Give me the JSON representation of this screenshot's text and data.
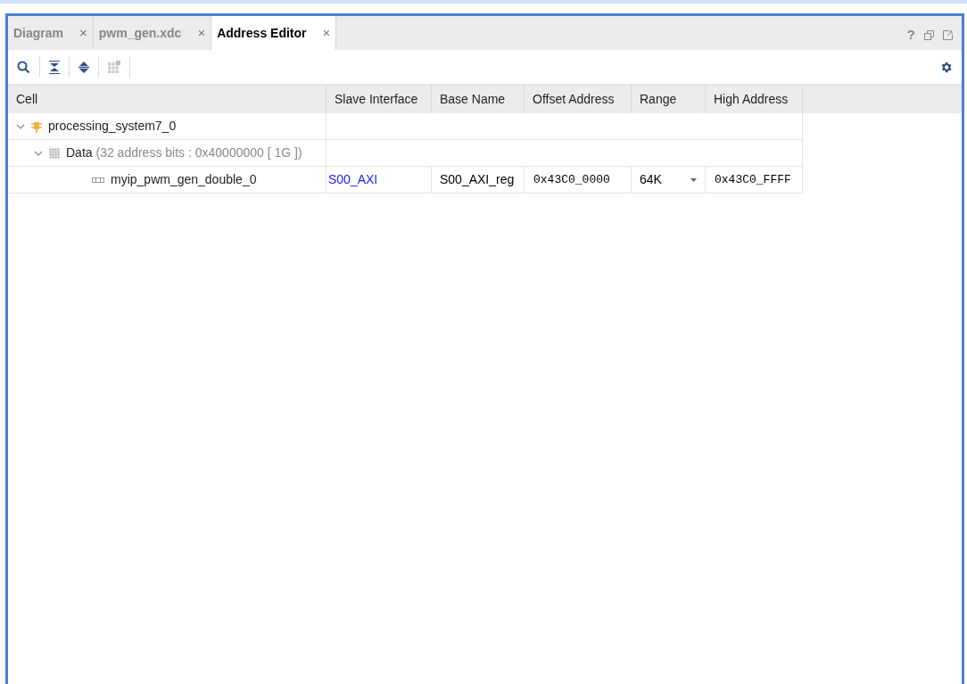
{
  "tabs": [
    {
      "label": "Diagram",
      "selected": false,
      "close": "×"
    },
    {
      "label": "pwm_gen.xdc",
      "selected": false,
      "close": "×"
    },
    {
      "label": "Address Editor",
      "selected": true,
      "close": "×"
    }
  ],
  "window_controls": {
    "help": "?"
  },
  "table": {
    "columns": [
      "Cell",
      "Slave Interface",
      "Base Name",
      "Offset Address",
      "Range",
      "High Address"
    ],
    "rows": [
      {
        "kind": "processor",
        "cell": "processing_system7_0",
        "expanded": true,
        "children": [
          {
            "kind": "space",
            "cell": "Data",
            "detail": "(32 address bits : 0x40000000 [ 1G ])",
            "expanded": true,
            "children": [
              {
                "kind": "slave",
                "cell": "myip_pwm_gen_double_0",
                "slave_interface": "S00_AXI",
                "base_name": "S00_AXI_reg",
                "offset_address": "0x43C0_0000",
                "range": "64K",
                "high_address": "0x43C0_FFFF"
              }
            ]
          }
        ]
      }
    ]
  }
}
